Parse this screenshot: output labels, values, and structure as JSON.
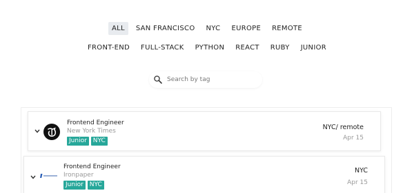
{
  "filters": {
    "row1": [
      "ALL",
      "SAN FRANCISCO",
      "NYC",
      "EUROPE",
      "REMOTE"
    ],
    "row2": [
      "FRONT-END",
      "FULL-STACK",
      "PYTHON",
      "REACT",
      "RUBY",
      "JUNIOR"
    ],
    "active": "ALL"
  },
  "search": {
    "placeholder": "Search by tag",
    "value": "",
    "icon": "search-icon"
  },
  "jobs": [
    {
      "title": "Frontend Engineer",
      "company": "New York Times",
      "tags": [
        "Junior",
        "NYC"
      ],
      "location": "NYC/ remote",
      "date": "Apr 15",
      "logo": "new-york-times-logo"
    },
    {
      "title": "Frontend Engineer",
      "company": "Ironpaper",
      "tags": [
        "Junior",
        "NYC"
      ],
      "location": "NYC",
      "date": "Apr 15",
      "logo": "ironpaper-logo"
    }
  ],
  "colors": {
    "tag_badge": "#27a79a",
    "active_filter_bg": "#e8ebef"
  }
}
